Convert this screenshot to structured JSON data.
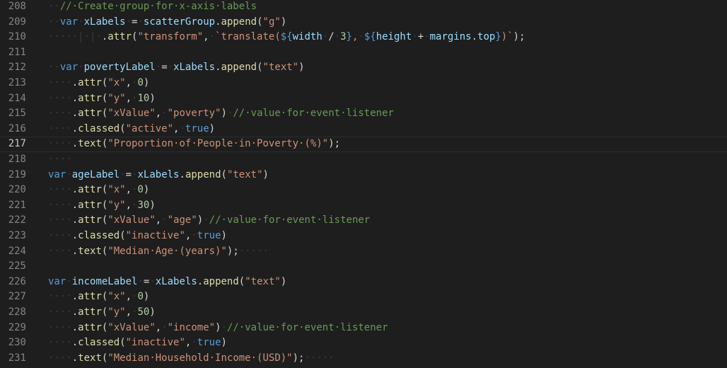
{
  "editor": {
    "lines": [
      {
        "number": "208",
        "tokens": [
          {
            "t": "ws",
            "v": "··"
          },
          {
            "t": "com",
            "v": "//·Create·group·for·x-axis·labels"
          }
        ]
      },
      {
        "number": "209",
        "tokens": [
          {
            "t": "ws",
            "v": "··"
          },
          {
            "t": "kw",
            "v": "var"
          },
          {
            "t": "ws",
            "v": "·"
          },
          {
            "t": "var",
            "v": "xLabels"
          },
          {
            "t": "ws",
            "v": "·"
          },
          {
            "t": "pun",
            "v": "="
          },
          {
            "t": "ws",
            "v": "·"
          },
          {
            "t": "var",
            "v": "scatterGroup"
          },
          {
            "t": "pun",
            "v": "."
          },
          {
            "t": "fn",
            "v": "append"
          },
          {
            "t": "pun",
            "v": "("
          },
          {
            "t": "str",
            "v": "\"g\""
          },
          {
            "t": "pun",
            "v": ")"
          }
        ]
      },
      {
        "number": "210",
        "tokens": [
          {
            "t": "ws",
            "v": "·····|·|·"
          },
          {
            "t": "pun",
            "v": "."
          },
          {
            "t": "fn",
            "v": "attr"
          },
          {
            "t": "pun",
            "v": "("
          },
          {
            "t": "str",
            "v": "\"transform\""
          },
          {
            "t": "pun",
            "v": ","
          },
          {
            "t": "ws",
            "v": "·"
          },
          {
            "t": "tpl",
            "v": "`translate("
          },
          {
            "t": "tplx",
            "v": "${"
          },
          {
            "t": "var",
            "v": "width"
          },
          {
            "t": "ws",
            "v": "·"
          },
          {
            "t": "pun",
            "v": "/"
          },
          {
            "t": "ws",
            "v": "·"
          },
          {
            "t": "num",
            "v": "3"
          },
          {
            "t": "tplx",
            "v": "}"
          },
          {
            "t": "tpl",
            "v": ","
          },
          {
            "t": "ws",
            "v": "·"
          },
          {
            "t": "tplx",
            "v": "${"
          },
          {
            "t": "var",
            "v": "height"
          },
          {
            "t": "ws",
            "v": "·"
          },
          {
            "t": "pun",
            "v": "+"
          },
          {
            "t": "ws",
            "v": "·"
          },
          {
            "t": "var",
            "v": "margins"
          },
          {
            "t": "pun",
            "v": "."
          },
          {
            "t": "var",
            "v": "top"
          },
          {
            "t": "tplx",
            "v": "}"
          },
          {
            "t": "tpl",
            "v": ")`"
          },
          {
            "t": "pun",
            "v": ");"
          }
        ]
      },
      {
        "number": "211",
        "tokens": []
      },
      {
        "number": "212",
        "tokens": [
          {
            "t": "ws",
            "v": "··"
          },
          {
            "t": "kw",
            "v": "var"
          },
          {
            "t": "ws",
            "v": "·"
          },
          {
            "t": "var",
            "v": "povertyLabel"
          },
          {
            "t": "ws",
            "v": "·"
          },
          {
            "t": "pun",
            "v": "="
          },
          {
            "t": "ws",
            "v": "·"
          },
          {
            "t": "var",
            "v": "xLabels"
          },
          {
            "t": "pun",
            "v": "."
          },
          {
            "t": "fn",
            "v": "append"
          },
          {
            "t": "pun",
            "v": "("
          },
          {
            "t": "str",
            "v": "\"text\""
          },
          {
            "t": "pun",
            "v": ")"
          }
        ]
      },
      {
        "number": "213",
        "tokens": [
          {
            "t": "ws",
            "v": "····"
          },
          {
            "t": "pun",
            "v": "."
          },
          {
            "t": "fn",
            "v": "attr"
          },
          {
            "t": "pun",
            "v": "("
          },
          {
            "t": "str",
            "v": "\"x\""
          },
          {
            "t": "pun",
            "v": ","
          },
          {
            "t": "ws",
            "v": "·"
          },
          {
            "t": "num",
            "v": "0"
          },
          {
            "t": "pun",
            "v": ")"
          }
        ]
      },
      {
        "number": "214",
        "tokens": [
          {
            "t": "ws",
            "v": "····"
          },
          {
            "t": "pun",
            "v": "."
          },
          {
            "t": "fn",
            "v": "attr"
          },
          {
            "t": "pun",
            "v": "("
          },
          {
            "t": "str",
            "v": "\"y\""
          },
          {
            "t": "pun",
            "v": ","
          },
          {
            "t": "ws",
            "v": "·"
          },
          {
            "t": "num",
            "v": "10"
          },
          {
            "t": "pun",
            "v": ")"
          }
        ]
      },
      {
        "number": "215",
        "tokens": [
          {
            "t": "ws",
            "v": "····"
          },
          {
            "t": "pun",
            "v": "."
          },
          {
            "t": "fn",
            "v": "attr"
          },
          {
            "t": "pun",
            "v": "("
          },
          {
            "t": "str",
            "v": "\"xValue\""
          },
          {
            "t": "pun",
            "v": ","
          },
          {
            "t": "ws",
            "v": "·"
          },
          {
            "t": "str",
            "v": "\"poverty\""
          },
          {
            "t": "pun",
            "v": ")"
          },
          {
            "t": "ws",
            "v": "·"
          },
          {
            "t": "com",
            "v": "//·value·for·event·listener"
          }
        ]
      },
      {
        "number": "216",
        "tokens": [
          {
            "t": "ws",
            "v": "····"
          },
          {
            "t": "pun",
            "v": "."
          },
          {
            "t": "fn",
            "v": "classed"
          },
          {
            "t": "pun",
            "v": "("
          },
          {
            "t": "str",
            "v": "\"active\""
          },
          {
            "t": "pun",
            "v": ","
          },
          {
            "t": "ws",
            "v": "·"
          },
          {
            "t": "bool",
            "v": "true"
          },
          {
            "t": "pun",
            "v": ")"
          }
        ]
      },
      {
        "number": "217",
        "current": true,
        "tokens": [
          {
            "t": "ws",
            "v": "····"
          },
          {
            "t": "pun",
            "v": "."
          },
          {
            "t": "fn",
            "v": "text"
          },
          {
            "t": "pun",
            "v": "("
          },
          {
            "t": "str",
            "v": "\"Proportion·of·People·in·Poverty·(%)\""
          },
          {
            "t": "pun",
            "v": ");"
          }
        ]
      },
      {
        "number": "218",
        "tokens": [
          {
            "t": "ws",
            "v": "····"
          }
        ]
      },
      {
        "number": "219",
        "tokens": [
          {
            "t": "kw",
            "v": "var"
          },
          {
            "t": "ws",
            "v": "·"
          },
          {
            "t": "var",
            "v": "ageLabel"
          },
          {
            "t": "ws",
            "v": "·"
          },
          {
            "t": "pun",
            "v": "="
          },
          {
            "t": "ws",
            "v": "·"
          },
          {
            "t": "var",
            "v": "xLabels"
          },
          {
            "t": "pun",
            "v": "."
          },
          {
            "t": "fn",
            "v": "append"
          },
          {
            "t": "pun",
            "v": "("
          },
          {
            "t": "str",
            "v": "\"text\""
          },
          {
            "t": "pun",
            "v": ")"
          }
        ]
      },
      {
        "number": "220",
        "tokens": [
          {
            "t": "ws",
            "v": "····"
          },
          {
            "t": "pun",
            "v": "."
          },
          {
            "t": "fn",
            "v": "attr"
          },
          {
            "t": "pun",
            "v": "("
          },
          {
            "t": "str",
            "v": "\"x\""
          },
          {
            "t": "pun",
            "v": ","
          },
          {
            "t": "ws",
            "v": "·"
          },
          {
            "t": "num",
            "v": "0"
          },
          {
            "t": "pun",
            "v": ")"
          }
        ]
      },
      {
        "number": "221",
        "tokens": [
          {
            "t": "ws",
            "v": "····"
          },
          {
            "t": "pun",
            "v": "."
          },
          {
            "t": "fn",
            "v": "attr"
          },
          {
            "t": "pun",
            "v": "("
          },
          {
            "t": "str",
            "v": "\"y\""
          },
          {
            "t": "pun",
            "v": ","
          },
          {
            "t": "ws",
            "v": "·"
          },
          {
            "t": "num",
            "v": "30"
          },
          {
            "t": "pun",
            "v": ")"
          }
        ]
      },
      {
        "number": "222",
        "tokens": [
          {
            "t": "ws",
            "v": "····"
          },
          {
            "t": "pun",
            "v": "."
          },
          {
            "t": "fn",
            "v": "attr"
          },
          {
            "t": "pun",
            "v": "("
          },
          {
            "t": "str",
            "v": "\"xValue\""
          },
          {
            "t": "pun",
            "v": ","
          },
          {
            "t": "ws",
            "v": "·"
          },
          {
            "t": "str",
            "v": "\"age\""
          },
          {
            "t": "pun",
            "v": ")"
          },
          {
            "t": "ws",
            "v": "·"
          },
          {
            "t": "com",
            "v": "//·value·for·event·listener"
          }
        ]
      },
      {
        "number": "223",
        "tokens": [
          {
            "t": "ws",
            "v": "····"
          },
          {
            "t": "pun",
            "v": "."
          },
          {
            "t": "fn",
            "v": "classed"
          },
          {
            "t": "pun",
            "v": "("
          },
          {
            "t": "str",
            "v": "\"inactive\""
          },
          {
            "t": "pun",
            "v": ","
          },
          {
            "t": "ws",
            "v": "·"
          },
          {
            "t": "bool",
            "v": "true"
          },
          {
            "t": "pun",
            "v": ")"
          }
        ]
      },
      {
        "number": "224",
        "tokens": [
          {
            "t": "ws",
            "v": "····"
          },
          {
            "t": "pun",
            "v": "."
          },
          {
            "t": "fn",
            "v": "text"
          },
          {
            "t": "pun",
            "v": "("
          },
          {
            "t": "str",
            "v": "\"Median·Age·(years)\""
          },
          {
            "t": "pun",
            "v": ");"
          },
          {
            "t": "ws",
            "v": "·····"
          }
        ]
      },
      {
        "number": "225",
        "tokens": []
      },
      {
        "number": "226",
        "tokens": [
          {
            "t": "kw",
            "v": "var"
          },
          {
            "t": "ws",
            "v": "·"
          },
          {
            "t": "var",
            "v": "incomeLabel"
          },
          {
            "t": "ws",
            "v": "·"
          },
          {
            "t": "pun",
            "v": "="
          },
          {
            "t": "ws",
            "v": "·"
          },
          {
            "t": "var",
            "v": "xLabels"
          },
          {
            "t": "pun",
            "v": "."
          },
          {
            "t": "fn",
            "v": "append"
          },
          {
            "t": "pun",
            "v": "("
          },
          {
            "t": "str",
            "v": "\"text\""
          },
          {
            "t": "pun",
            "v": ")"
          }
        ]
      },
      {
        "number": "227",
        "tokens": [
          {
            "t": "ws",
            "v": "····"
          },
          {
            "t": "pun",
            "v": "."
          },
          {
            "t": "fn",
            "v": "attr"
          },
          {
            "t": "pun",
            "v": "("
          },
          {
            "t": "str",
            "v": "\"x\""
          },
          {
            "t": "pun",
            "v": ","
          },
          {
            "t": "ws",
            "v": "·"
          },
          {
            "t": "num",
            "v": "0"
          },
          {
            "t": "pun",
            "v": ")"
          }
        ]
      },
      {
        "number": "228",
        "tokens": [
          {
            "t": "ws",
            "v": "····"
          },
          {
            "t": "pun",
            "v": "."
          },
          {
            "t": "fn",
            "v": "attr"
          },
          {
            "t": "pun",
            "v": "("
          },
          {
            "t": "str",
            "v": "\"y\""
          },
          {
            "t": "pun",
            "v": ","
          },
          {
            "t": "ws",
            "v": "·"
          },
          {
            "t": "num",
            "v": "50"
          },
          {
            "t": "pun",
            "v": ")"
          }
        ]
      },
      {
        "number": "229",
        "tokens": [
          {
            "t": "ws",
            "v": "····"
          },
          {
            "t": "pun",
            "v": "."
          },
          {
            "t": "fn",
            "v": "attr"
          },
          {
            "t": "pun",
            "v": "("
          },
          {
            "t": "str",
            "v": "\"xValue\""
          },
          {
            "t": "pun",
            "v": ","
          },
          {
            "t": "ws",
            "v": "·"
          },
          {
            "t": "str",
            "v": "\"income\""
          },
          {
            "t": "pun",
            "v": ")"
          },
          {
            "t": "ws",
            "v": "·"
          },
          {
            "t": "com",
            "v": "//·value·for·event·listener"
          }
        ]
      },
      {
        "number": "230",
        "tokens": [
          {
            "t": "ws",
            "v": "····"
          },
          {
            "t": "pun",
            "v": "."
          },
          {
            "t": "fn",
            "v": "classed"
          },
          {
            "t": "pun",
            "v": "("
          },
          {
            "t": "str",
            "v": "\"inactive\""
          },
          {
            "t": "pun",
            "v": ","
          },
          {
            "t": "ws",
            "v": "·"
          },
          {
            "t": "bool",
            "v": "true"
          },
          {
            "t": "pun",
            "v": ")"
          }
        ]
      },
      {
        "number": "231",
        "tokens": [
          {
            "t": "ws",
            "v": "····"
          },
          {
            "t": "pun",
            "v": "."
          },
          {
            "t": "fn",
            "v": "text"
          },
          {
            "t": "pun",
            "v": "("
          },
          {
            "t": "str",
            "v": "\"Median·Household·Income·(USD)\""
          },
          {
            "t": "pun",
            "v": ");"
          },
          {
            "t": "ws",
            "v": "·····"
          }
        ]
      }
    ]
  }
}
